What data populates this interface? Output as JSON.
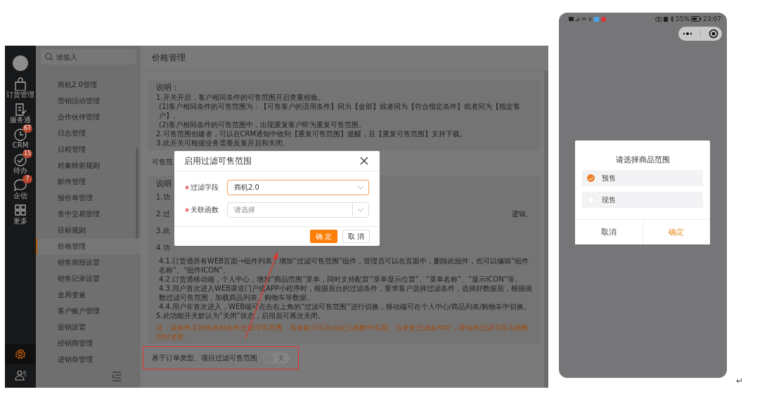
{
  "left_screenshot": {
    "rail": {
      "items": [
        {
          "label": "订货管理"
        },
        {
          "label": "服务通"
        },
        {
          "label": "CRM",
          "badge": "67"
        },
        {
          "label": "待办",
          "badge": "15"
        },
        {
          "label": "企信",
          "badge": "7"
        },
        {
          "label": "更多"
        }
      ]
    },
    "nav": {
      "search_placeholder": "请输入",
      "items": [
        {
          "label": "商机2.0管理",
          "selected": false
        },
        {
          "label": "营销活动管理",
          "selected": false
        },
        {
          "label": "合作伙伴管理",
          "selected": false
        },
        {
          "label": "日志管理",
          "selected": false
        },
        {
          "label": "日程管理",
          "selected": false
        },
        {
          "label": "对象映射规则",
          "selected": false
        },
        {
          "label": "邮件管理",
          "selected": false
        },
        {
          "label": "报价单管理",
          "selected": false
        },
        {
          "label": "售中交易管理",
          "selected": false
        },
        {
          "label": "目标规则",
          "selected": false
        },
        {
          "label": "价格管理",
          "selected": true
        },
        {
          "label": "销售简报设置",
          "selected": false
        },
        {
          "label": "销售记录设置",
          "selected": false
        },
        {
          "label": "全局变量",
          "selected": false
        },
        {
          "label": "客户账户管理",
          "selected": false
        },
        {
          "label": "促销设置",
          "selected": false
        },
        {
          "label": "经销商管理",
          "selected": false
        },
        {
          "label": "进销存管理",
          "selected": false
        }
      ]
    },
    "page_title": "价格管理",
    "card_1": {
      "heading": "说明：",
      "lines": [
        {
          "text": "1.开关开启，客户相同条件的可售范围开启查重校验。",
          "indent": false
        },
        {
          "text": "(1)客户相同条件的可售范围为：【可售客户的适用条件】同为【全部】或者同为【符合指定条件】或者同为【指定客户】。",
          "indent": true
        },
        {
          "text": "(2)客户相同条件的可售范围中，出现重复客户即为重复可售范围。",
          "indent": true
        },
        {
          "text": "2.可售范围创建者，可以在CRM通知中收到【重复可售范围】提醒，且【重复可售范围】支持下载。",
          "indent": false
        },
        {
          "text": "3.此开关可根据业务需要反复开启和关闭。",
          "indent": false
        }
      ]
    },
    "setting_label_fragment": "可售范",
    "card_2": {
      "heading": "说明",
      "fragments": [
        "1.功",
        "2.过",
        "3.此",
        "4.功"
      ],
      "fragment_tail": "逻辑。",
      "lines": [
        {
          "text": "4.1.订货通所有WEB页面→组件列表：增加“过滤可售范围”组件，管理员可以在页面中，删除此组件，也可以编辑“组件名称”、“组件ICON”。",
          "indent": true
        },
        {
          "text": "4.2.订货通移动端，个人中心，增加“商品范围”菜单，同时支持配置“菜单显示位置”、“菜单名称”、“显示ICON”等。",
          "indent": true
        },
        {
          "text": "4.3.用户首次进入WEB渠道门户或APP小程序时，根据后台的过滤条件，要求客户选择过滤条件，选择好数据后，根据函数过滤可售范围，加载商品列表、购物车等数据。",
          "indent": true
        },
        {
          "text": "4.4.用户非首次进入，WEB端可点击右上角的“过滤可售范围”进行切换，移动端可在个人中心/商品列表/购物车中切换。",
          "indent": true
        },
        {
          "text": "5.此功能开关默认为“关闭”状态，启用后可再次关闭。",
          "indent": false
        }
      ],
      "note": "注：该插件支持按各种条件过滤可售范围，具体能力可在自定义函数中实现。当变更过滤条件时，请保持过滤字段与函数同时变更。"
    },
    "toggle": {
      "label": "基于订单类型、项目过滤可售范围",
      "on": false,
      "state_text": "关"
    },
    "modal": {
      "title": "启用过滤可售范围",
      "fields": [
        {
          "label": "过滤字段",
          "required": true,
          "value": "商机2.0",
          "focused": true
        },
        {
          "label": "关联函数",
          "required": true,
          "placeholder": "请选择",
          "focused": false
        }
      ],
      "buttons": [
        {
          "label": "确 定",
          "kind": "primary"
        },
        {
          "label": "取 消",
          "kind": "default"
        }
      ]
    }
  },
  "phone": {
    "status_bar": {
      "battery": "55%",
      "time": "23:07"
    },
    "dialog": {
      "title": "请选择商品范围",
      "options": [
        {
          "label": "预售",
          "selected": true
        },
        {
          "label": "现售",
          "selected": false
        }
      ],
      "buttons": [
        {
          "label": "取消",
          "kind": "cancel"
        },
        {
          "label": "确定",
          "kind": "confirm"
        }
      ]
    }
  },
  "return_mark": "↵"
}
